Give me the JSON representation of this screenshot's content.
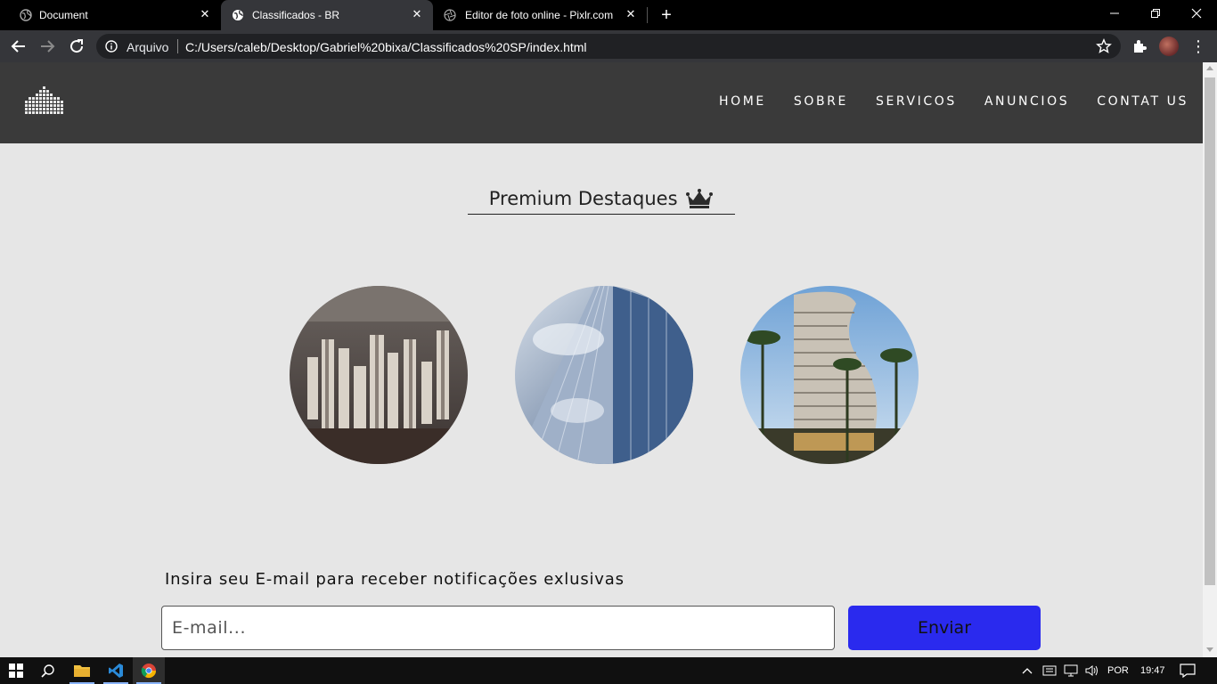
{
  "browser": {
    "tabs": [
      {
        "title": "Document"
      },
      {
        "title": "Classificados - BR"
      },
      {
        "title": "Editor de foto online - Pixlr.com"
      }
    ],
    "address": {
      "scheme_label": "Arquivo",
      "url": "C:/Users/caleb/Desktop/Gabriel%20bixa/Classificados%20SP/index.html"
    }
  },
  "site": {
    "nav": [
      "HOME",
      "SOBRE",
      "SERVICOS",
      "ANUNCIOS",
      "CONTAT US"
    ],
    "premium_title": "Premium Destaques",
    "newsletter": {
      "label": "Insira seu E-mail para receber notificações exlusivas",
      "placeholder": "E-mail...",
      "button": "Enviar"
    },
    "colors": {
      "header_bg": "#3a3a3a",
      "page_bg": "#e6e6e6",
      "button_bg": "#2a2aee"
    }
  },
  "taskbar": {
    "language": "POR",
    "time": "19:47"
  }
}
